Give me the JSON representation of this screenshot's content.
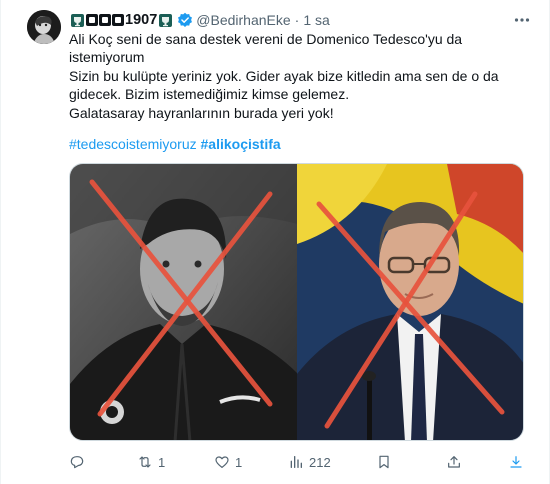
{
  "tweet": {
    "author": {
      "display_name_suffix": "1907",
      "handle": "@BedirhanEke",
      "verified": true,
      "avatar_icon": "avatar-dark-portrait"
    },
    "separator": "·",
    "time": "1 sa",
    "text_lines": [
      "Ali Koç seni de sana destek vereni de Domenico Tedesco'yu da",
      "istemiyorum",
      "Sizin bu kulüpte yeriniz yok. Gider ayak bize kitledin ama sen de o da",
      "gidecek. Bizim istemediğimiz kimse gelemez.",
      "Galatasaray hayranlarının burada yeri yok!"
    ],
    "hashtags": [
      "#tedescoistemiyoruz",
      "#alikoçistifa"
    ],
    "media_icons": [
      "photo-man-with-red-x",
      "photo-man-with-red-x"
    ],
    "actions": {
      "reply_count": "",
      "retweet_count": "1",
      "like_count": "1",
      "views_count": "212"
    },
    "colors": {
      "link": "#1d9bf0",
      "muted": "#536471",
      "cross": "#e8533d"
    }
  }
}
